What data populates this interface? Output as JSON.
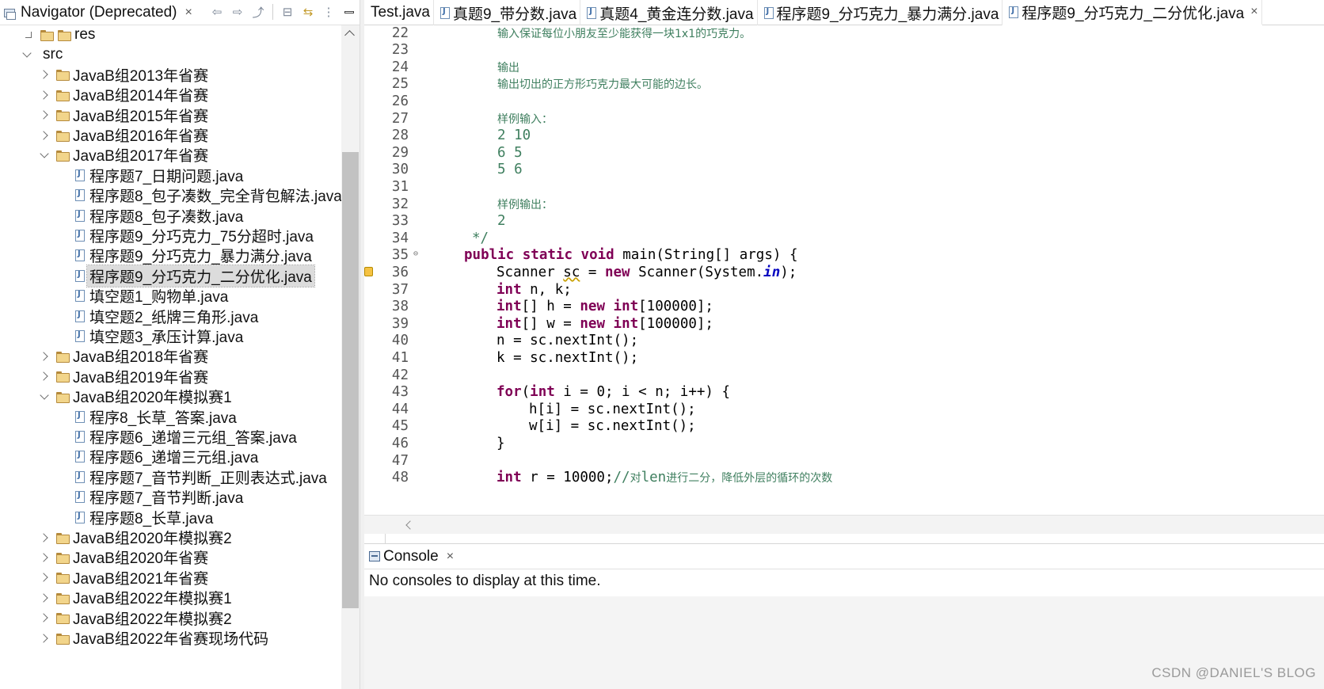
{
  "navigator": {
    "title": "Navigator (Deprecated)",
    "close": "×",
    "toolbar": {
      "back": "⇦",
      "forward": "⇨",
      "up": "⤴",
      "collapse": "⊟",
      "link": "⇆",
      "menu": "⋮"
    },
    "tree": [
      {
        "type": "folder",
        "label": "res",
        "level": 1,
        "expanded": null
      },
      {
        "type": "folder",
        "label": "src",
        "level": 0,
        "expanded": true,
        "bare": true
      },
      {
        "type": "folder",
        "label": "JavaB组2013年省赛",
        "level": 1,
        "expanded": false
      },
      {
        "type": "folder",
        "label": "JavaB组2014年省赛",
        "level": 1,
        "expanded": false
      },
      {
        "type": "folder",
        "label": "JavaB组2015年省赛",
        "level": 1,
        "expanded": false
      },
      {
        "type": "folder",
        "label": "JavaB组2016年省赛",
        "level": 1,
        "expanded": false
      },
      {
        "type": "folder",
        "label": "JavaB组2017年省赛",
        "level": 1,
        "expanded": true
      },
      {
        "type": "file",
        "label": "程序题7_日期问题.java",
        "level": 2
      },
      {
        "type": "file",
        "label": "程序题8_包子凑数_完全背包解法.java",
        "level": 2
      },
      {
        "type": "file",
        "label": "程序题8_包子凑数.java",
        "level": 2
      },
      {
        "type": "file",
        "label": "程序题9_分巧克力_75分超时.java",
        "level": 2
      },
      {
        "type": "file",
        "label": "程序题9_分巧克力_暴力满分.java",
        "level": 2
      },
      {
        "type": "file",
        "label": "程序题9_分巧克力_二分优化.java",
        "level": 2,
        "selected": true
      },
      {
        "type": "file",
        "label": "填空题1_购物单.java",
        "level": 2
      },
      {
        "type": "file",
        "label": "填空题2_纸牌三角形.java",
        "level": 2
      },
      {
        "type": "file",
        "label": "填空题3_承压计算.java",
        "level": 2
      },
      {
        "type": "folder",
        "label": "JavaB组2018年省赛",
        "level": 1,
        "expanded": false
      },
      {
        "type": "folder",
        "label": "JavaB组2019年省赛",
        "level": 1,
        "expanded": false
      },
      {
        "type": "folder",
        "label": "JavaB组2020年模拟赛1",
        "level": 1,
        "expanded": true
      },
      {
        "type": "file",
        "label": "程序8_长草_答案.java",
        "level": 2
      },
      {
        "type": "file",
        "label": "程序题6_递增三元组_答案.java",
        "level": 2
      },
      {
        "type": "file",
        "label": "程序题6_递增三元组.java",
        "level": 2
      },
      {
        "type": "file",
        "label": "程序题7_音节判断_正则表达式.java",
        "level": 2
      },
      {
        "type": "file",
        "label": "程序题7_音节判断.java",
        "level": 2
      },
      {
        "type": "file",
        "label": "程序题8_长草.java",
        "level": 2
      },
      {
        "type": "folder",
        "label": "JavaB组2020年模拟赛2",
        "level": 1,
        "expanded": false
      },
      {
        "type": "folder",
        "label": "JavaB组2020年省赛",
        "level": 1,
        "expanded": false
      },
      {
        "type": "folder",
        "label": "JavaB组2021年省赛",
        "level": 1,
        "expanded": false
      },
      {
        "type": "folder",
        "label": "JavaB组2022年模拟赛1",
        "level": 1,
        "expanded": false
      },
      {
        "type": "folder",
        "label": "JavaB组2022年模拟赛2",
        "level": 1,
        "expanded": false
      },
      {
        "type": "folder",
        "label": "JavaB组2022年省赛现场代码",
        "level": 1,
        "expanded": false
      }
    ]
  },
  "editor": {
    "tabs": [
      {
        "label": "Test.java",
        "active": false
      },
      {
        "label": "真题9_带分数.java",
        "active": false
      },
      {
        "label": "真题4_黄金连分数.java",
        "active": false
      },
      {
        "label": "程序题9_分巧克力_暴力满分.java",
        "active": false
      },
      {
        "label": "程序题9_分巧克力_二分优化.java",
        "active": true,
        "close": "×"
      }
    ],
    "lines": [
      {
        "n": "22",
        "indent": 0,
        "parts": [
          [
            "cmz",
            "输入保证每位小朋友至少能获得一块1x1的巧克力。"
          ]
        ],
        "comment_indent": true
      },
      {
        "n": "23",
        "parts": []
      },
      {
        "n": "24",
        "parts": [
          [
            "cmz",
            "输出"
          ]
        ],
        "comment_indent": true
      },
      {
        "n": "25",
        "parts": [
          [
            "cmz",
            "输出切出的正方形巧克力最大可能的边长。"
          ]
        ],
        "comment_indent": true
      },
      {
        "n": "26",
        "parts": []
      },
      {
        "n": "27",
        "parts": [
          [
            "cmz",
            "样例输入："
          ]
        ],
        "comment_indent": true
      },
      {
        "n": "28",
        "parts": [
          [
            "cm",
            "2 10"
          ]
        ],
        "comment_indent": true
      },
      {
        "n": "29",
        "parts": [
          [
            "cm",
            "6 5"
          ]
        ],
        "comment_indent": true
      },
      {
        "n": "30",
        "parts": [
          [
            "cm",
            "5 6"
          ]
        ],
        "comment_indent": true
      },
      {
        "n": "31",
        "parts": []
      },
      {
        "n": "32",
        "parts": [
          [
            "cmz",
            "样例输出："
          ]
        ],
        "comment_indent": true
      },
      {
        "n": "33",
        "parts": [
          [
            "cm",
            "2"
          ]
        ],
        "comment_indent": true
      },
      {
        "n": "34",
        "parts": [
          [
            "cm",
            "*/"
          ]
        ],
        "close_indent": true
      },
      {
        "n": "35",
        "fold": true,
        "indent": 1,
        "parts": [
          [
            "kw",
            "public"
          ],
          [
            "",
            " "
          ],
          [
            "kw",
            "static"
          ],
          [
            "",
            " "
          ],
          [
            "kw",
            "void"
          ],
          [
            "",
            " main(String[] args) {"
          ]
        ]
      },
      {
        "n": "36",
        "marker": true,
        "indent": 2,
        "parts": [
          [
            "",
            "Scanner "
          ],
          [
            "warn",
            "sc"
          ],
          [
            "",
            " = "
          ],
          [
            "kw",
            "new"
          ],
          [
            "",
            " Scanner(System."
          ],
          [
            "fld",
            "in"
          ],
          [
            "",
            ");"
          ]
        ]
      },
      {
        "n": "37",
        "indent": 2,
        "parts": [
          [
            "kw",
            "int"
          ],
          [
            "",
            " n, k;"
          ]
        ]
      },
      {
        "n": "38",
        "indent": 2,
        "parts": [
          [
            "kw",
            "int"
          ],
          [
            "",
            "[] h = "
          ],
          [
            "kw",
            "new"
          ],
          [
            "",
            " "
          ],
          [
            "kw",
            "int"
          ],
          [
            "",
            "[100000];"
          ]
        ]
      },
      {
        "n": "39",
        "indent": 2,
        "parts": [
          [
            "kw",
            "int"
          ],
          [
            "",
            "[] w = "
          ],
          [
            "kw",
            "new"
          ],
          [
            "",
            " "
          ],
          [
            "kw",
            "int"
          ],
          [
            "",
            "[100000];"
          ]
        ]
      },
      {
        "n": "40",
        "indent": 2,
        "parts": [
          [
            "",
            "n = sc.nextInt();"
          ]
        ]
      },
      {
        "n": "41",
        "indent": 2,
        "parts": [
          [
            "",
            "k = sc.nextInt();"
          ]
        ]
      },
      {
        "n": "42",
        "parts": []
      },
      {
        "n": "43",
        "indent": 2,
        "parts": [
          [
            "kw",
            "for"
          ],
          [
            "",
            "("
          ],
          [
            "kw",
            "int"
          ],
          [
            "",
            " i = 0; i < n; i++) {"
          ]
        ]
      },
      {
        "n": "44",
        "indent": 3,
        "parts": [
          [
            "",
            "h[i] = sc.nextInt();"
          ]
        ]
      },
      {
        "n": "45",
        "indent": 3,
        "parts": [
          [
            "",
            "w[i] = sc.nextInt();"
          ]
        ]
      },
      {
        "n": "46",
        "indent": 2,
        "parts": [
          [
            "",
            "}"
          ]
        ]
      },
      {
        "n": "47",
        "parts": []
      },
      {
        "n": "48",
        "indent": 2,
        "parts": [
          [
            "kw",
            "int"
          ],
          [
            "",
            " r = 10000;"
          ],
          [
            "cm",
            "//"
          ],
          [
            "cmz",
            "对"
          ],
          [
            "cm",
            "len"
          ],
          [
            "cmz",
            "进行二分，降低外层的循环的次数"
          ]
        ]
      }
    ]
  },
  "console": {
    "tab_label": "Console",
    "close": "×",
    "message": "No consoles to display at this time."
  },
  "watermark": "CSDN @DANIEL'S BLOG"
}
